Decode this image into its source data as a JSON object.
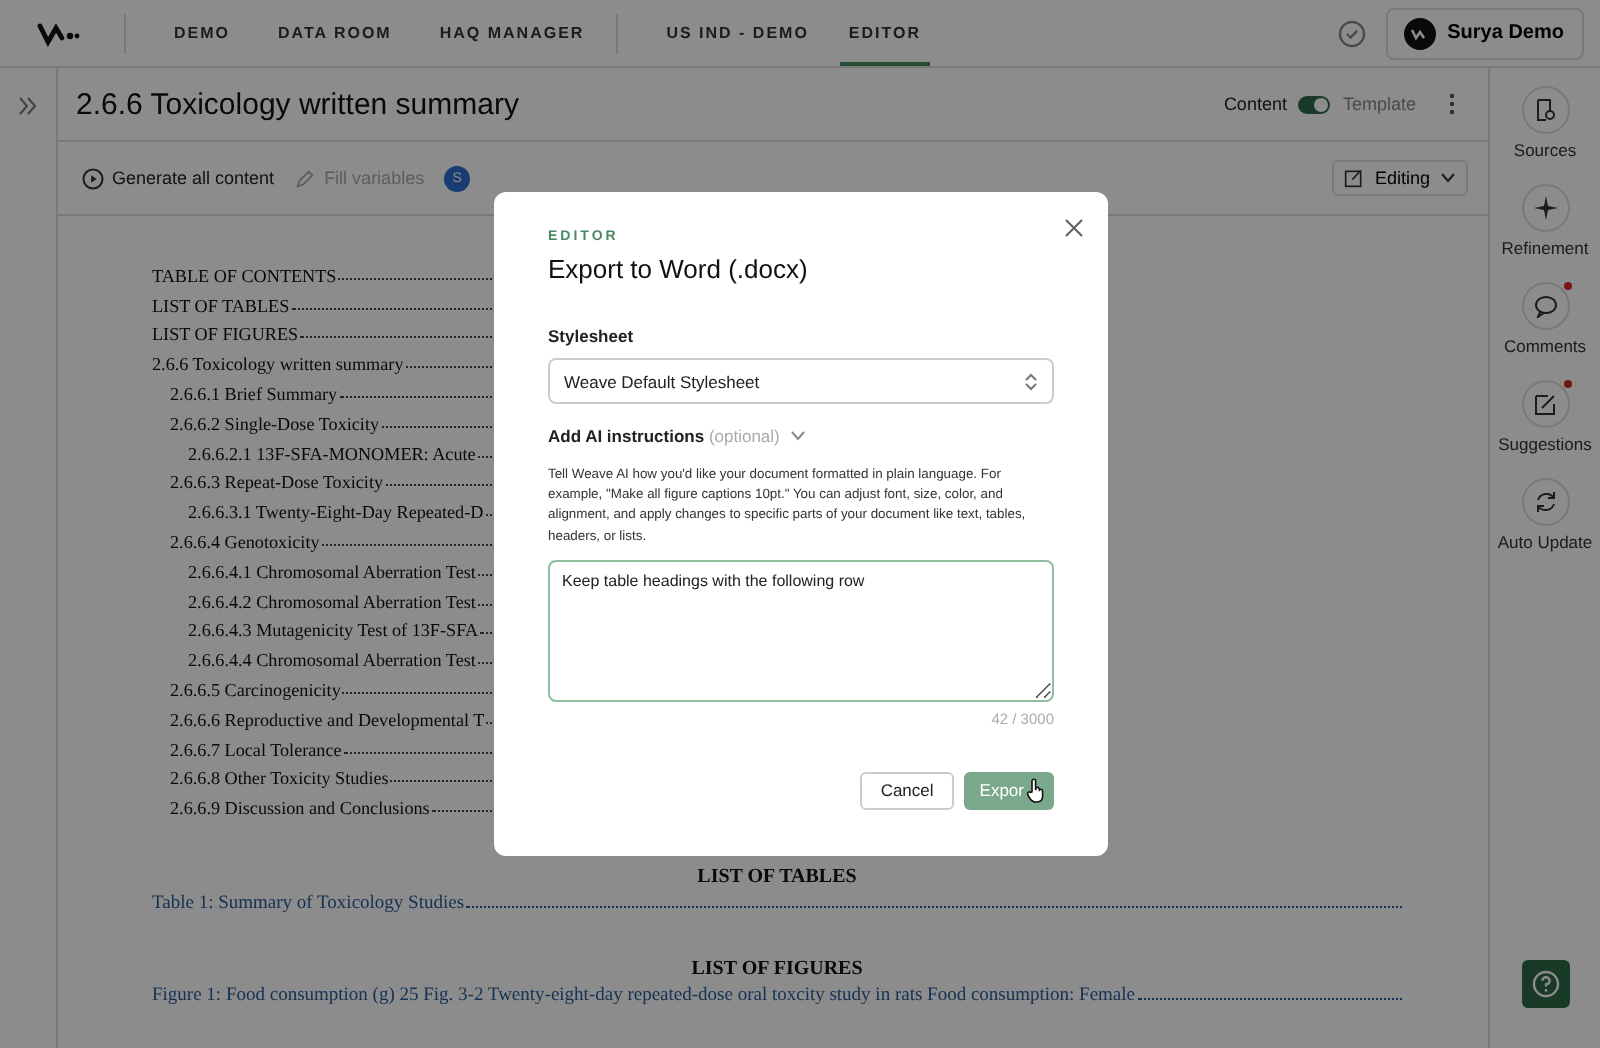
{
  "nav": {
    "items": [
      {
        "label": "DEMO",
        "selected": false
      },
      {
        "label": "DATA ROOM",
        "selected": false
      },
      {
        "label": "HAQ MANAGER",
        "selected": false
      },
      {
        "label": "US IND - DEMO",
        "selected": false
      },
      {
        "label": "EDITOR",
        "selected": true
      }
    ],
    "user": "Surya Demo"
  },
  "header": {
    "title": "2.6.6 Toxicology written summary",
    "toggle_left": "Content",
    "toggle_right": "Template",
    "toggle_on": true
  },
  "toolbar": {
    "generate": "Generate all content",
    "fill": "Fill variables",
    "fill_disabled": true,
    "avatar": "S",
    "mode": "Editing"
  },
  "toc": [
    {
      "text": "TABLE OF CONTENTS"
    },
    {
      "text": "LIST OF TABLES"
    },
    {
      "text": "LIST OF FIGURES"
    },
    {
      "text": "2.6.6 Toxicology written summary",
      "children": [
        {
          "text": "2.6.6.1 Brief Summary"
        },
        {
          "text": "2.6.6.2 Single-Dose Toxicity",
          "children": [
            {
              "text": "2.6.6.2.1 13F-SFA-MONOMER: Acute"
            }
          ]
        },
        {
          "text": "2.6.6.3 Repeat-Dose Toxicity",
          "children": [
            {
              "text": "2.6.6.3.1 Twenty-Eight-Day Repeated-D"
            }
          ]
        },
        {
          "text": "2.6.6.4 Genotoxicity",
          "children": [
            {
              "text": "2.6.6.4.1 Chromosomal Aberration Test"
            },
            {
              "text": "2.6.6.4.2 Chromosomal Aberration Test"
            },
            {
              "text": "2.6.6.4.3 Mutagenicity Test of 13F-SFA"
            },
            {
              "text": "2.6.6.4.4 Chromosomal Aberration Test"
            }
          ]
        },
        {
          "text": "2.6.6.5 Carcinogenicity"
        },
        {
          "text": "2.6.6.6 Reproductive and Developmental T"
        },
        {
          "text": "2.6.6.7 Local Tolerance"
        },
        {
          "text": "2.6.6.8 Other Toxicity Studies"
        },
        {
          "text": "2.6.6.9 Discussion and Conclusions"
        }
      ]
    }
  ],
  "lists": [
    {
      "heading": "LIST OF TABLES",
      "entries": [
        "Table 1: Summary of Toxicology Studies"
      ]
    },
    {
      "heading": "LIST OF FIGURES",
      "entries": [
        "Figure 1: Food consumption (g) 25 Fig. 3-2 Twenty-eight-day repeated-dose oral toxcity study in rats Food consumption: Female"
      ]
    }
  ],
  "rail": [
    {
      "label": "Sources",
      "kind": "sources",
      "badge": false
    },
    {
      "label": "Refinement",
      "kind": "sparkle",
      "badge": false
    },
    {
      "label": "Comments",
      "kind": "comments",
      "badge": true
    },
    {
      "label": "Suggestions",
      "kind": "suggest",
      "badge": true
    },
    {
      "label": "Auto Update",
      "kind": "refresh",
      "badge": false
    }
  ],
  "dialog": {
    "eyebrow": "EDITOR",
    "title": "Export to Word (.docx)",
    "stylesheet_label": "Stylesheet",
    "stylesheet": "Weave Default Stylesheet",
    "ai_label": "Add AI instructions",
    "ai_optional": "(optional)",
    "ai_expanded": true,
    "help": "Tell Weave AI how you'd like your document formatted in plain language. For example, \"Make all figure captions 10pt.\" You can adjust font, size, color, and alignment, and apply changes to specific parts of your document like text, tables, headers, or lists.",
    "instructions": "Keep table headings with the following row",
    "counter": "42 / 3000",
    "cancel": "Cancel",
    "export": "Expor"
  }
}
